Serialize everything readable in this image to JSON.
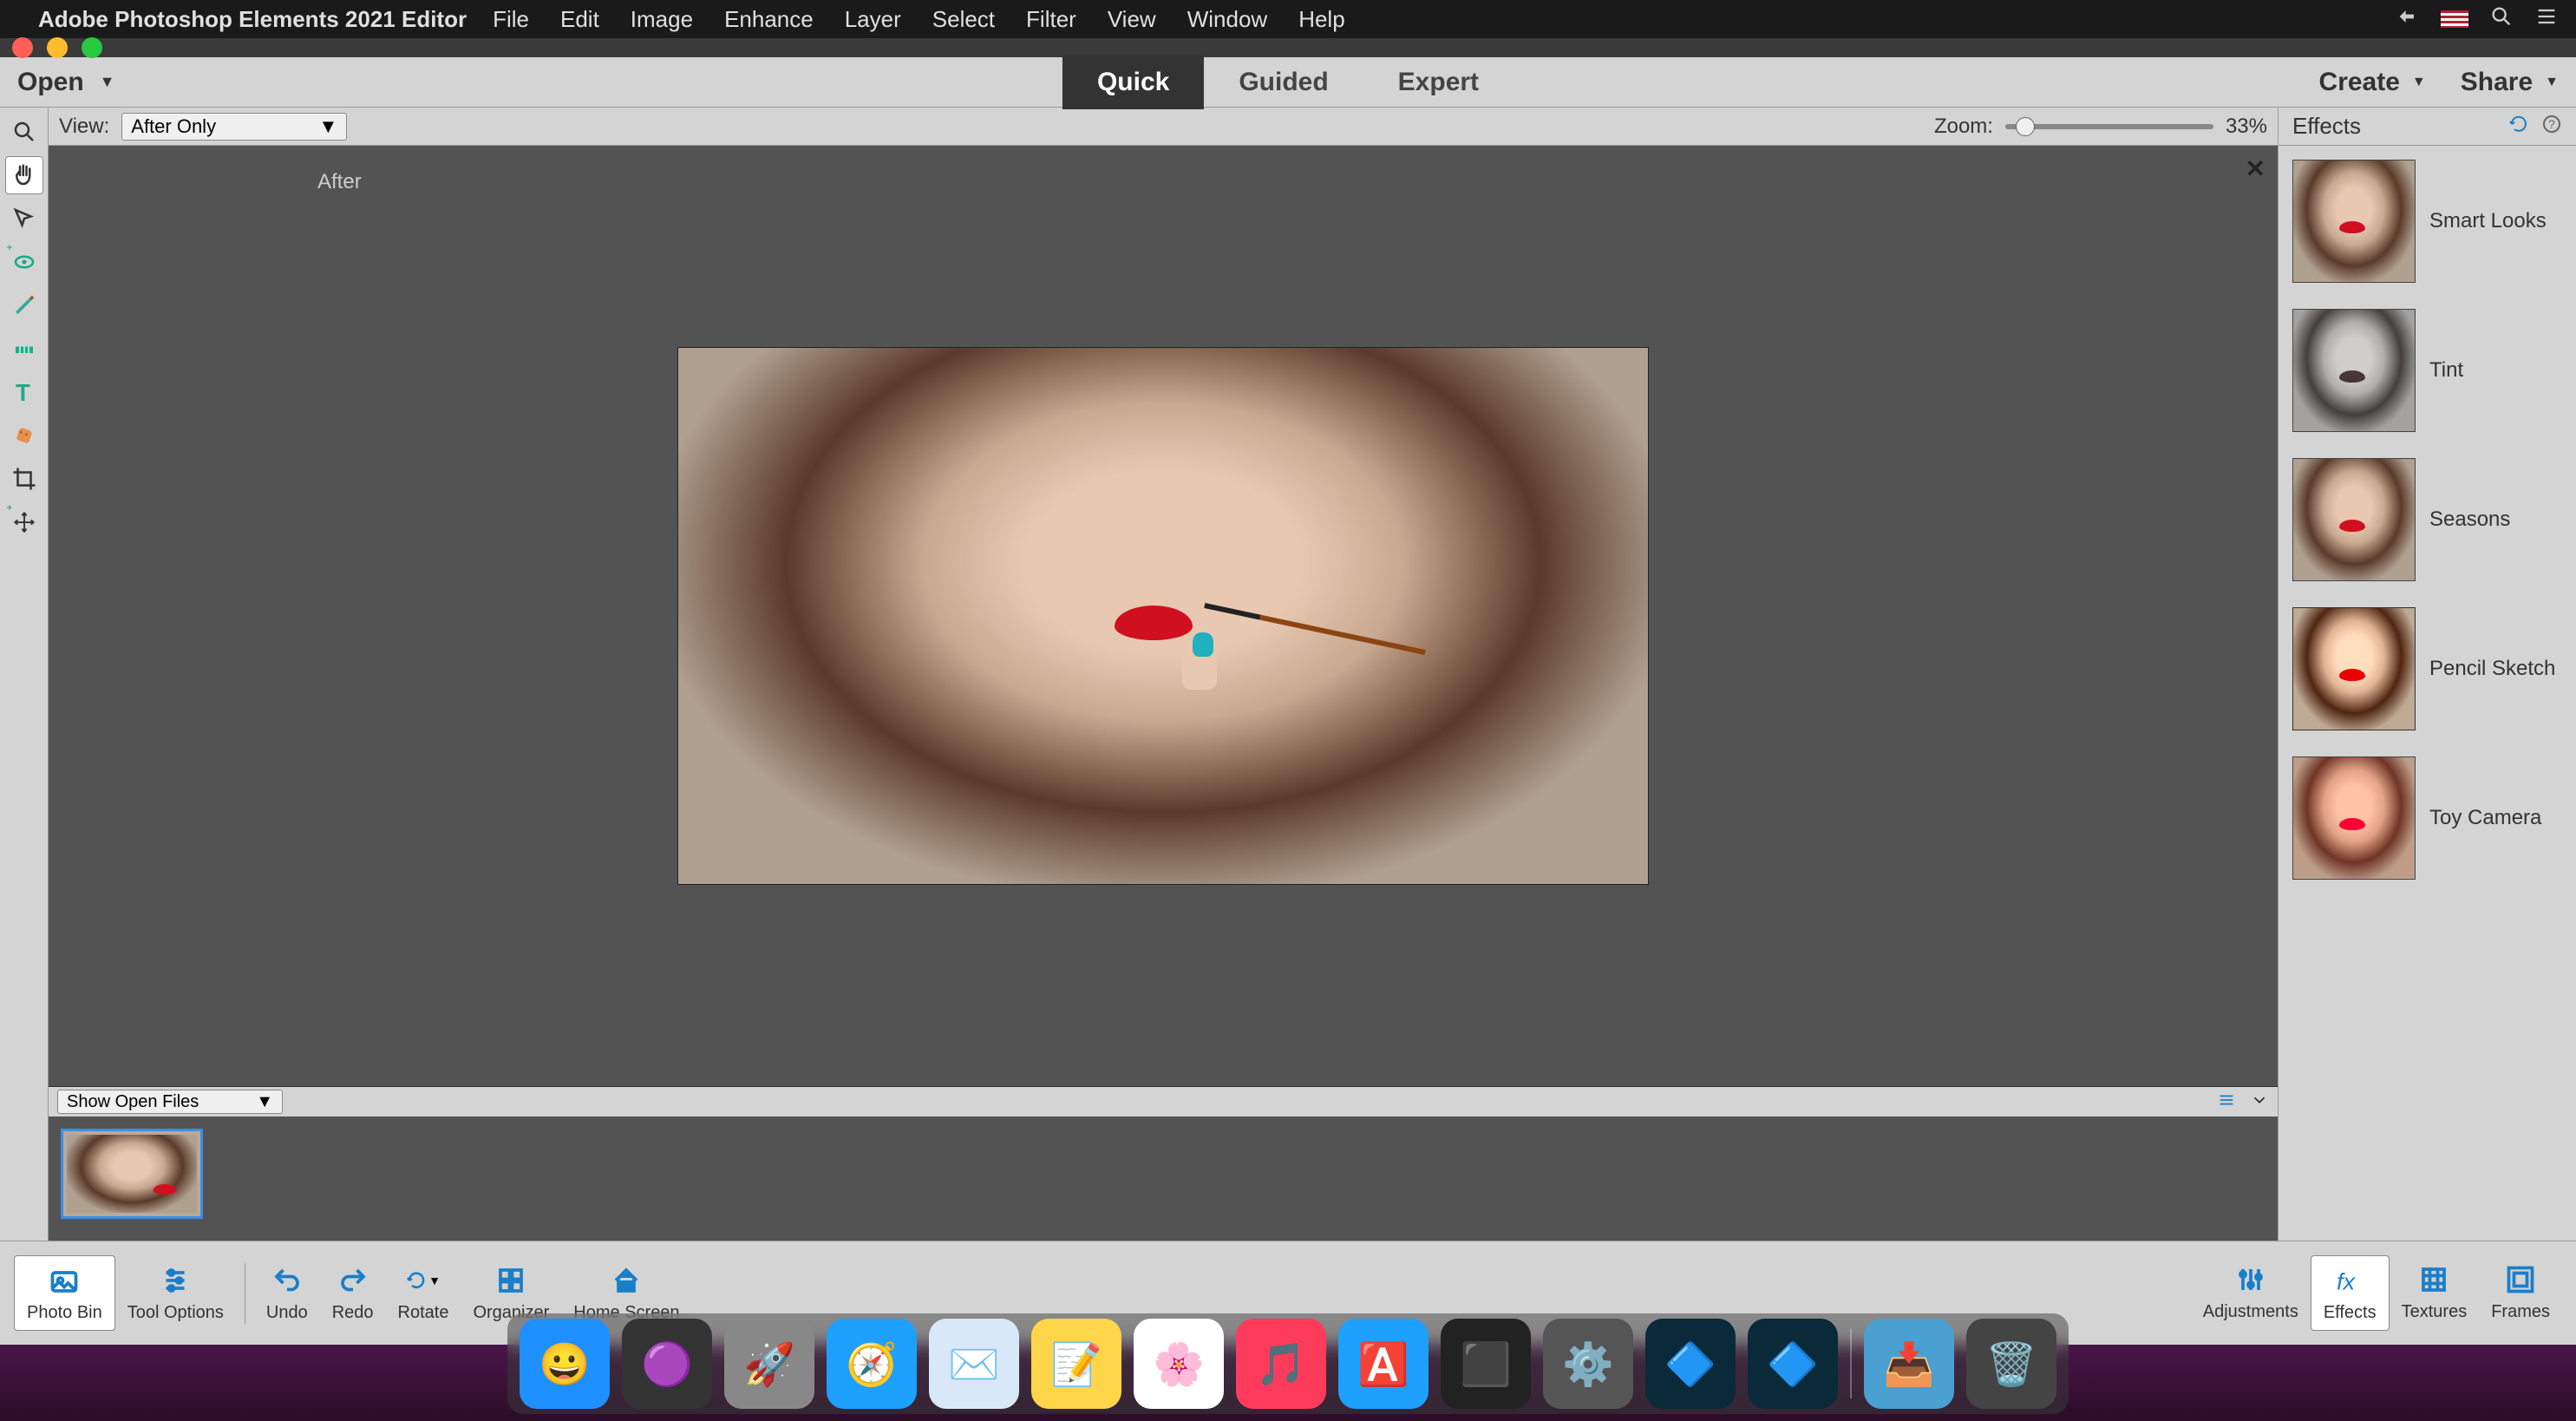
{
  "menubar": {
    "app_title": "Adobe Photoshop Elements 2021 Editor",
    "items": [
      "File",
      "Edit",
      "Image",
      "Enhance",
      "Layer",
      "Select",
      "Filter",
      "View",
      "Window",
      "Help"
    ]
  },
  "topbar": {
    "open_label": "Open",
    "mode_tabs": [
      "Quick",
      "Guided",
      "Expert"
    ],
    "active_mode": "Quick",
    "create_label": "Create",
    "share_label": "Share"
  },
  "canvas": {
    "view_label": "View:",
    "view_selected": "After Only",
    "zoom_label": "Zoom:",
    "zoom_value": "33%",
    "after_label": "After"
  },
  "tools": [
    {
      "name": "zoom-tool",
      "selected": false
    },
    {
      "name": "hand-tool",
      "selected": true
    },
    {
      "name": "quick-select-tool",
      "selected": false
    },
    {
      "name": "eye-tool",
      "selected": false
    },
    {
      "name": "whiten-teeth-tool",
      "selected": false
    },
    {
      "name": "straighten-tool",
      "selected": false
    },
    {
      "name": "type-tool",
      "selected": false
    },
    {
      "name": "spot-heal-tool",
      "selected": false
    },
    {
      "name": "crop-tool",
      "selected": false
    },
    {
      "name": "move-tool",
      "selected": false
    }
  ],
  "effects_panel": {
    "title": "Effects",
    "items": [
      {
        "name": "Smart Looks",
        "style": "normal"
      },
      {
        "name": "Tint",
        "style": "tint"
      },
      {
        "name": "Seasons",
        "style": "normal"
      },
      {
        "name": "Pencil Sketch",
        "style": "sketch"
      },
      {
        "name": "Toy Camera",
        "style": "toy"
      }
    ]
  },
  "photobin": {
    "select_label": "Show Open Files"
  },
  "bottom_toolbar": {
    "left": [
      {
        "name": "photo-bin",
        "label": "Photo Bin",
        "active": true
      },
      {
        "name": "tool-options",
        "label": "Tool Options",
        "active": false
      }
    ],
    "mid": [
      {
        "name": "undo",
        "label": "Undo"
      },
      {
        "name": "redo",
        "label": "Redo"
      },
      {
        "name": "rotate",
        "label": "Rotate"
      },
      {
        "name": "organizer",
        "label": "Organizer"
      },
      {
        "name": "home-screen",
        "label": "Home Screen"
      }
    ],
    "right": [
      {
        "name": "adjustments",
        "label": "Adjustments"
      },
      {
        "name": "effects",
        "label": "Effects",
        "active": true
      },
      {
        "name": "textures",
        "label": "Textures"
      },
      {
        "name": "frames",
        "label": "Frames"
      }
    ]
  },
  "dock": {
    "items": [
      {
        "name": "finder",
        "color": "#1e90ff"
      },
      {
        "name": "siri",
        "color": "#333"
      },
      {
        "name": "launchpad",
        "color": "#888"
      },
      {
        "name": "safari",
        "color": "#1ea0ff"
      },
      {
        "name": "mail",
        "color": "#d8e8f8"
      },
      {
        "name": "notes",
        "color": "#ffd54a"
      },
      {
        "name": "photos",
        "color": "#fff"
      },
      {
        "name": "music",
        "color": "#ff3b5c"
      },
      {
        "name": "app-store",
        "color": "#1ea0ff"
      },
      {
        "name": "terminal",
        "color": "#222"
      },
      {
        "name": "system-preferences",
        "color": "#555"
      },
      {
        "name": "pse-editor",
        "color": "#0a2a3a"
      },
      {
        "name": "pse-organizer",
        "color": "#0a2a3a"
      },
      {
        "name": "downloads",
        "color": "#4aa0d0"
      },
      {
        "name": "trash",
        "color": "#444"
      }
    ]
  }
}
